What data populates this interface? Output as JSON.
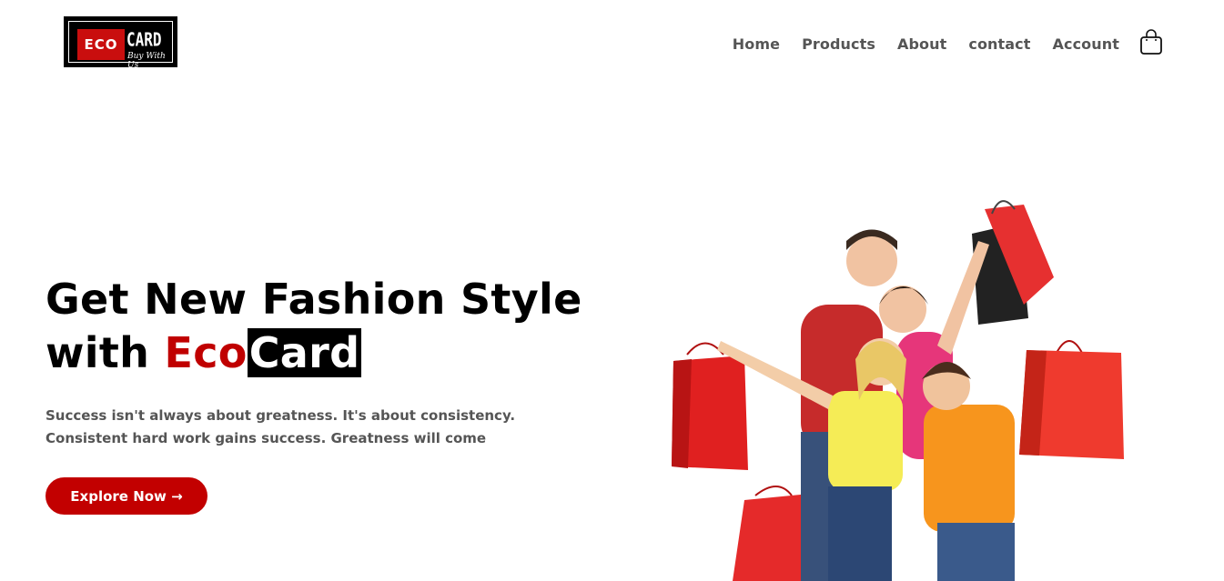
{
  "brand": {
    "logo_eco": "ECO",
    "logo_card": "CARD",
    "logo_tagline": "Buy With Us"
  },
  "nav": {
    "items": [
      {
        "label": "Home"
      },
      {
        "label": "Products"
      },
      {
        "label": "About"
      },
      {
        "label": "contact"
      },
      {
        "label": "Account"
      }
    ],
    "cart_icon": "shopping-bag-icon"
  },
  "hero": {
    "title_line1": "Get New Fashion Style",
    "title_with": "with ",
    "title_eco": "Eco",
    "title_card": "Card",
    "subtitle": "Success isn't always about greatness. It's about consistency. Consistent hard work gains success. Greatness will come",
    "cta_label": "Explore Now →",
    "image_subject": "family with shopping bags"
  },
  "colors": {
    "accent": "#c20000",
    "text_dark": "#000000",
    "text_muted": "#555555",
    "background": "#ffffff"
  }
}
